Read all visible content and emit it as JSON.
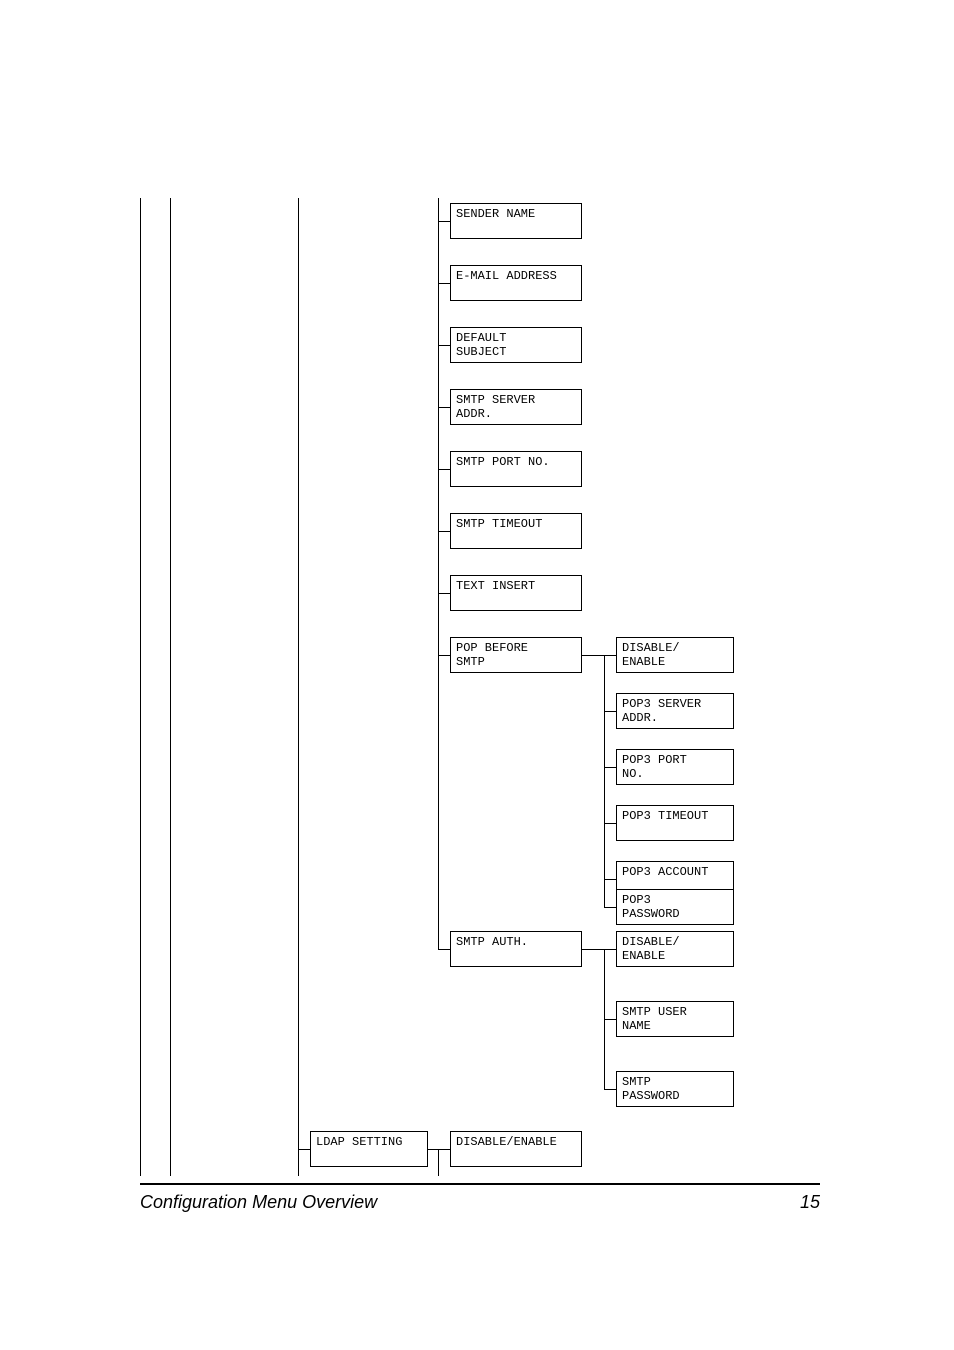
{
  "footer": {
    "title": "Configuration Menu Overview",
    "page": "15"
  },
  "col3": {
    "b1": "SENDER NAME",
    "b2": "E-MAIL ADDRESS",
    "b3": "DEFAULT\nSUBJECT",
    "b4": "SMTP SERVER\nADDR.",
    "b5": "SMTP PORT NO.",
    "b6": "SMTP TIMEOUT",
    "b7": "TEXT INSERT",
    "b8": "POP BEFORE\nSMTP",
    "b9": "SMTP AUTH.",
    "ldap": "LDAP SETTING",
    "ldap_val": "DISABLE/ENABLE"
  },
  "col4": {
    "pop1": "DISABLE/\nENABLE",
    "pop2": "POP3 SERVER\nADDR.",
    "pop3": "POP3 PORT\nNO.",
    "pop4": "POP3 TIMEOUT",
    "pop5": "POP3 ACCOUNT",
    "pop6": "POP3\nPASSWORD",
    "smtp1": "DISABLE/\nENABLE",
    "smtp2": "SMTP USER\nNAME",
    "smtp3": "SMTP\nPASSWORD"
  }
}
